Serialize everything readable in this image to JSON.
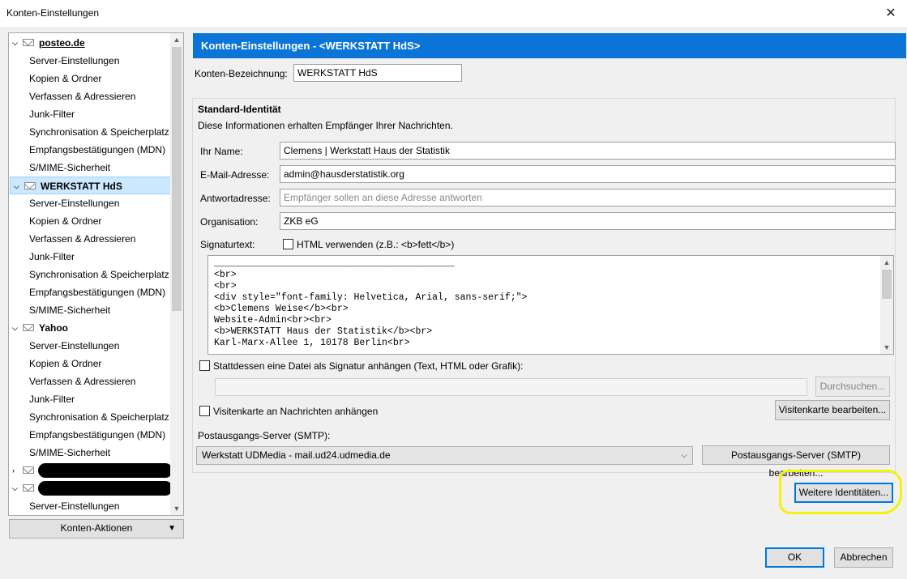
{
  "window": {
    "title": "Konten-Einstellungen",
    "close_glyph": "✕"
  },
  "tree": {
    "accounts": [
      {
        "name": "posteo.de",
        "expanded": true,
        "selected": false,
        "items": [
          "Server-Einstellungen",
          "Kopien & Ordner",
          "Verfassen & Adressieren",
          "Junk-Filter",
          "Synchronisation & Speicherplatz",
          "Empfangsbestätigungen (MDN)",
          "S/MIME-Sicherheit"
        ]
      },
      {
        "name": "WERKSTATT HdS",
        "expanded": true,
        "selected": true,
        "items": [
          "Server-Einstellungen",
          "Kopien & Ordner",
          "Verfassen & Adressieren",
          "Junk-Filter",
          "Synchronisation & Speicherplatz",
          "Empfangsbestätigungen (MDN)",
          "S/MIME-Sicherheit"
        ]
      },
      {
        "name": "Yahoo",
        "expanded": true,
        "selected": false,
        "items": [
          "Server-Einstellungen",
          "Kopien & Ordner",
          "Verfassen & Adressieren",
          "Junk-Filter",
          "Synchronisation & Speicherplatz",
          "Empfangsbestätigungen (MDN)",
          "S/MIME-Sicherheit"
        ]
      }
    ],
    "last_item": "Server-Einstellungen",
    "actions_button": "Konten-Aktionen"
  },
  "header": {
    "title": "Konten-Einstellungen - <WERKSTATT HdS>"
  },
  "account_name": {
    "label": "Konten-Bezeichnung:",
    "value": "WERKSTATT HdS"
  },
  "identity": {
    "heading": "Standard-Identität",
    "description": "Diese Informationen erhalten Empfänger Ihrer Nachrichten.",
    "name_label": "Ihr Name:",
    "name_value": "Clemens | Werkstatt Haus der Statistik",
    "email_label": "E-Mail-Adresse:",
    "email_value": "admin@hausderstatistik.org",
    "reply_label": "Antwortadresse:",
    "reply_placeholder": "Empfänger sollen an diese Adresse antworten",
    "org_label": "Organisation:",
    "org_value": "ZKB eG",
    "sig_label": "Signaturtext:",
    "html_checkbox": "HTML verwenden (z.B.: <b>fett</b>)",
    "signature": "___________________________________________\n<br>\n<br>\n<div style=\"font-family: Helvetica, Arial, sans-serif;\">\n<b>Clemens Weise</b><br>\nWebsite-Admin<br><br>\n<b>WERKSTATT Haus der Statistik</b><br>\nKarl-Marx-Allee 1, 10178 Berlin<br>",
    "file_checkbox": "Stattdessen eine Datei als Signatur anhängen (Text, HTML oder Grafik):",
    "browse_button": "Durchsuchen...",
    "vcard_checkbox": "Visitenkarte an Nachrichten anhängen",
    "vcard_button": "Visitenkarte bearbeiten...",
    "smtp_label": "Postausgangs-Server (SMTP):",
    "smtp_value": "Werkstatt UDMedia - mail.ud24.udmedia.de",
    "smtp_button": "Postausgangs-Server (SMTP) bearbeiten..."
  },
  "more_identities_button": "Weitere Identitäten...",
  "ok_button": "OK",
  "cancel_button": "Abbrechen",
  "colors": {
    "banner": "#0a75d6",
    "selection": "#cce8ff",
    "highlight": "#f2f20a"
  }
}
